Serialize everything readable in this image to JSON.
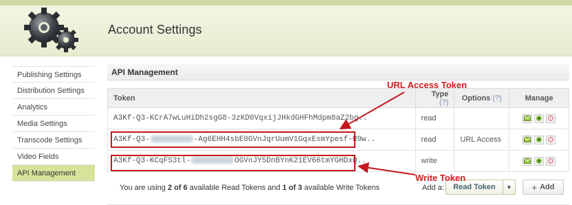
{
  "header": {
    "title": "Account Settings",
    "logo_icon": "gears-icon"
  },
  "sidebar": {
    "items": [
      {
        "label": "Publishing Settings",
        "active": false
      },
      {
        "label": "Distribution Settings",
        "active": false
      },
      {
        "label": "Analytics",
        "active": false
      },
      {
        "label": "Media Settings",
        "active": false
      },
      {
        "label": "Transcode Settings",
        "active": false
      },
      {
        "label": "Video Fields",
        "active": false
      },
      {
        "label": "API Management",
        "active": true
      }
    ],
    "active_color": "#d7e29a"
  },
  "section": {
    "title": "API Management"
  },
  "table": {
    "columns": {
      "token": "Token",
      "type": "Type",
      "type_help": "(?)",
      "options": "Options",
      "options_help": "(?)",
      "manage": "Manage"
    },
    "rows": [
      {
        "token_prefix": "A3Kf-Q3-KCrA7wLuHiDh2sgG8-3zKD0VqxijJHkdGHFhMdpm8aZ2bg..",
        "token_suffix": "",
        "type": "read",
        "options": ""
      },
      {
        "token_prefix": "A3Kf-Q3-",
        "token_suffix": "-Ag6EHH4sbE0GVnJqrUumV1GqxEsmYpesf-R9w..",
        "type": "read",
        "options": "URL Access"
      },
      {
        "token_prefix": "A3Kf-Q3-KCqFS3tl-",
        "token_suffix": "OGVnJY5DnBYnK21EV66tmYGHDxQ..",
        "type": "write",
        "options": ""
      }
    ],
    "manage_icons": [
      "email-icon",
      "refresh-icon",
      "delete-icon"
    ]
  },
  "footer": {
    "text_pre": "You are using ",
    "read_used": "2 of 6",
    "text_mid": " available Read Tokens and ",
    "write_used": "1 of 3",
    "text_post": " available Write Tokens",
    "add_label": "Add a:",
    "select_value": "Read Token",
    "add_button": "Add",
    "add_icon": "plus-icon"
  },
  "annotations": {
    "url_access": "URL Access Token",
    "write": "Write Token",
    "color": "#d01c1f"
  }
}
